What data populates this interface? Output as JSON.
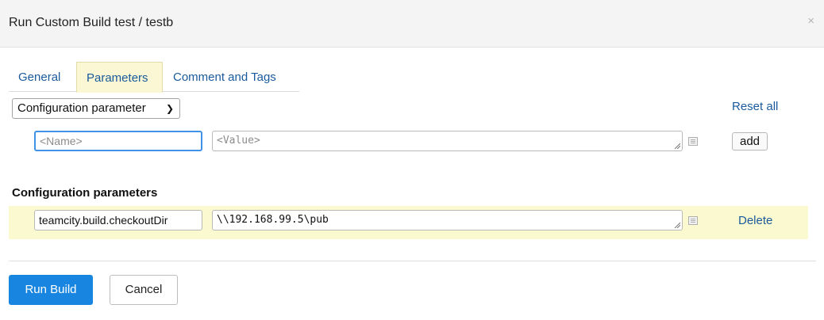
{
  "dialog": {
    "title": "Run Custom Build test / testb",
    "close_glyph": "×"
  },
  "tabs": [
    {
      "label": "General",
      "active": false
    },
    {
      "label": "Parameters",
      "active": true
    },
    {
      "label": "Comment and Tags",
      "active": false
    }
  ],
  "parameter_type": {
    "selected": "Configuration parameter",
    "chevron_icon": "chevron-down-icon"
  },
  "reset_all_label": "Reset all",
  "new_param": {
    "name_placeholder": "<Name>",
    "value_placeholder": "<Value>",
    "add_label": "add",
    "expand_icon": "expand-editor-icon"
  },
  "section": {
    "title": "Configuration parameters"
  },
  "params": [
    {
      "name": "teamcity.build.checkoutDir",
      "value": "\\\\192.168.99.5\\pub",
      "delete_label": "Delete",
      "expand_icon": "expand-editor-icon"
    }
  ],
  "footer": {
    "run_label": "Run Build",
    "cancel_label": "Cancel"
  },
  "colors": {
    "primary": "#1886e0",
    "link": "#1a5a9c",
    "active_tab_bg": "#fbf7d4",
    "param_row_bg": "#fbf9cf",
    "focus_border": "#3f92e6"
  }
}
